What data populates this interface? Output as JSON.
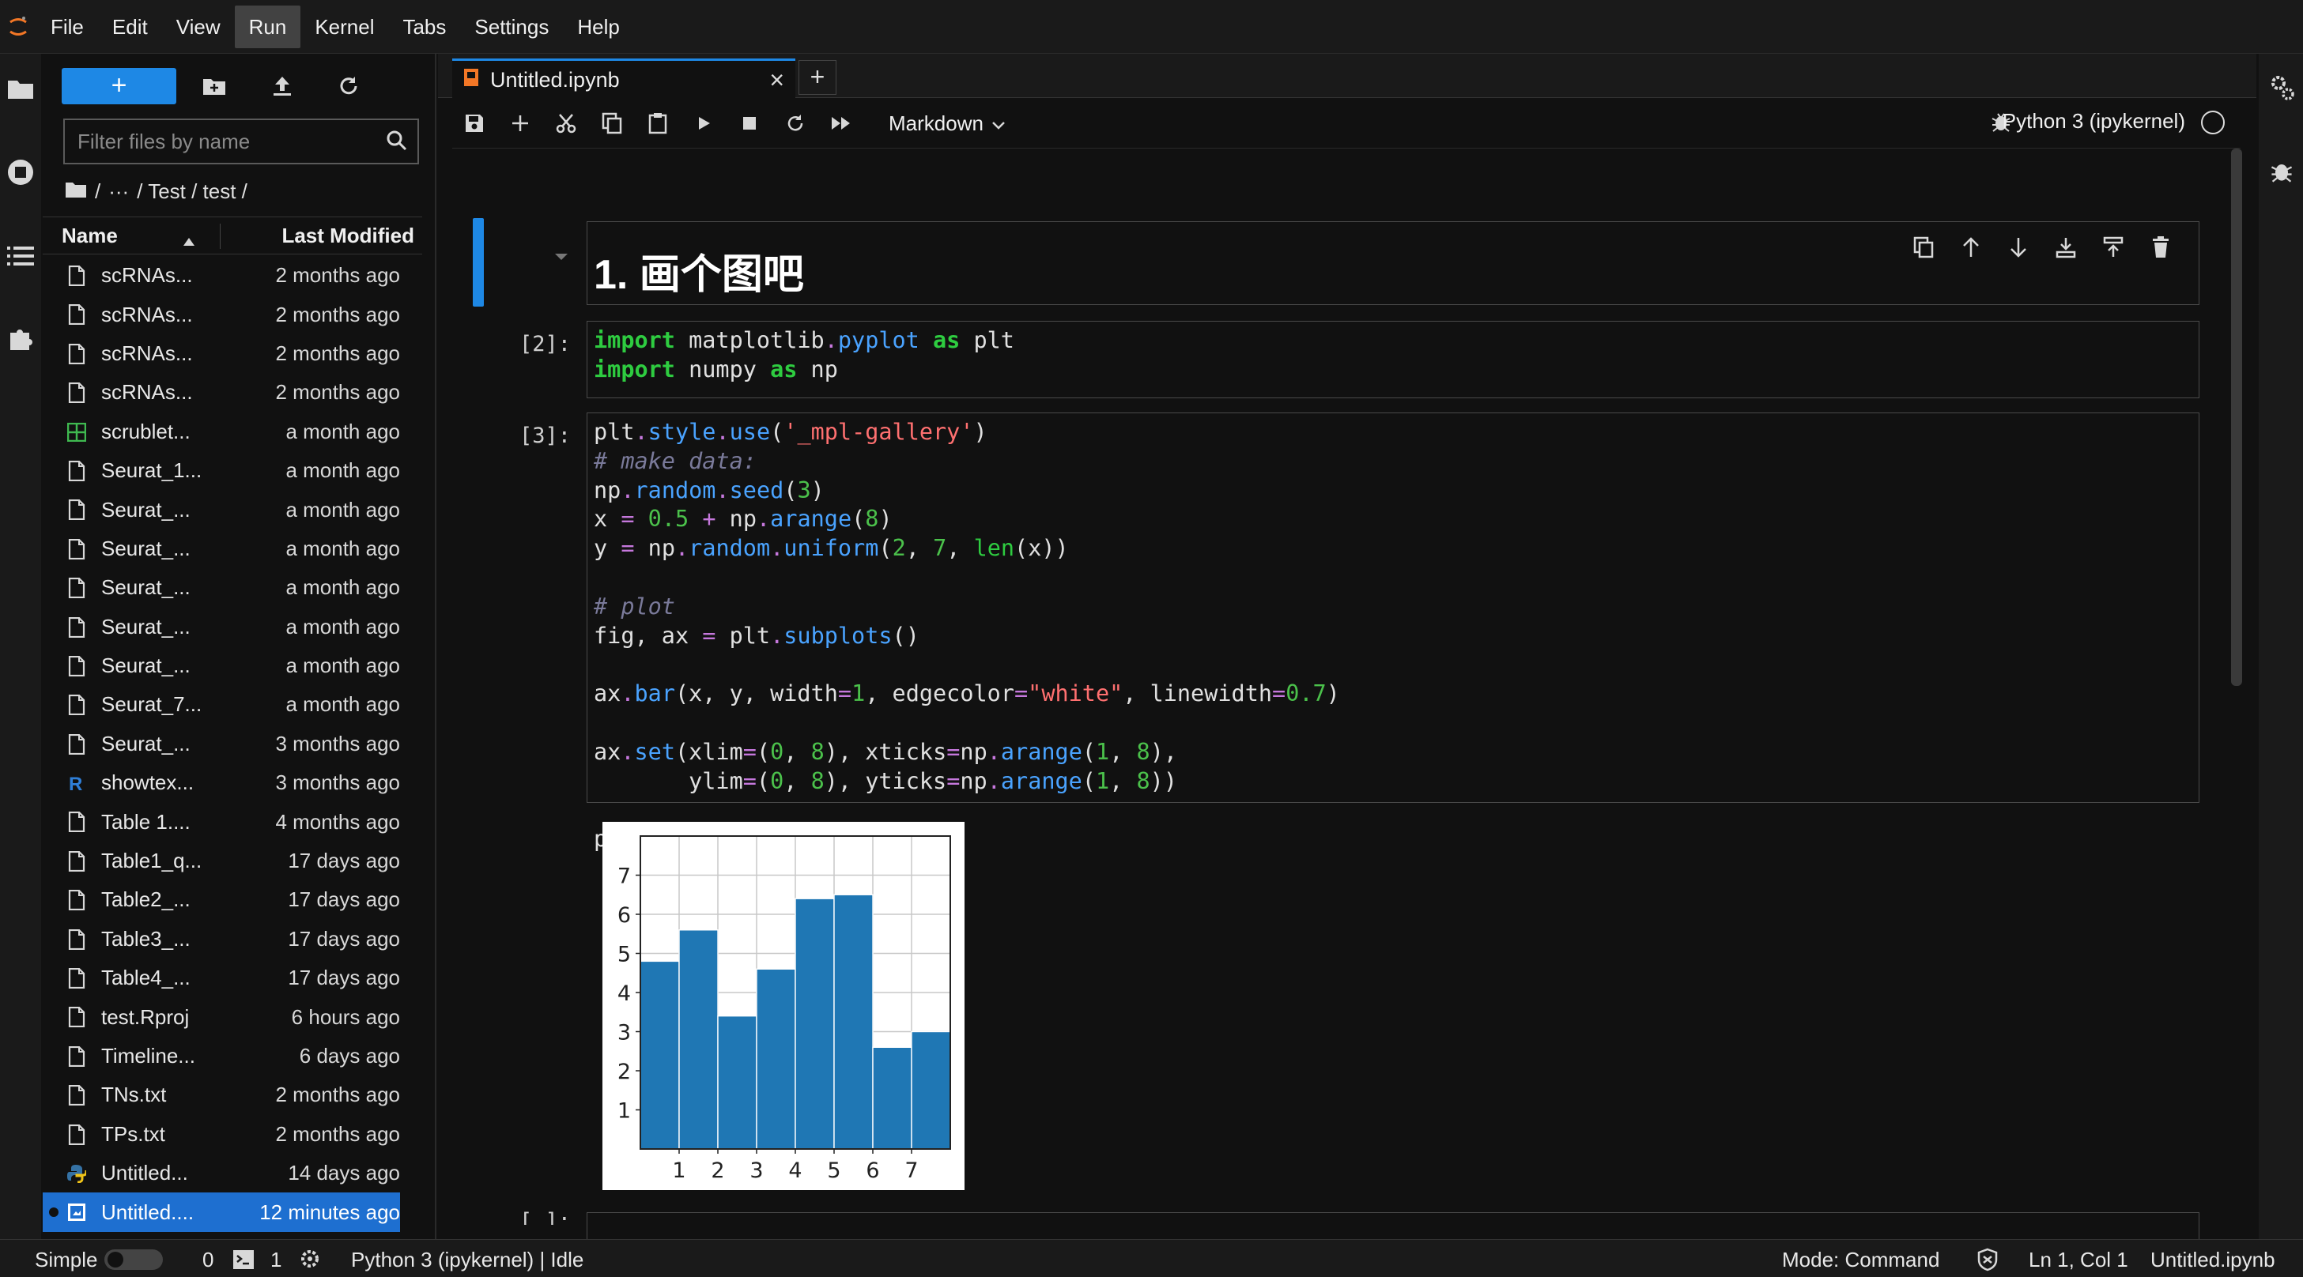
{
  "menubar": {
    "items": [
      "File",
      "Edit",
      "View",
      "Run",
      "Kernel",
      "Tabs",
      "Settings",
      "Help"
    ],
    "active": "Run"
  },
  "filebrowser": {
    "filter_placeholder": "Filter files by name",
    "breadcrumb": [
      "/",
      "···",
      "/ Test / test /"
    ],
    "header": {
      "name": "Name",
      "modified": "Last Modified"
    },
    "files": [
      {
        "name": "scRNAs...",
        "modified": "2 months ago",
        "icon": "file-icon"
      },
      {
        "name": "scRNAs...",
        "modified": "2 months ago",
        "icon": "file-icon"
      },
      {
        "name": "scRNAs...",
        "modified": "2 months ago",
        "icon": "file-icon"
      },
      {
        "name": "scRNAs...",
        "modified": "2 months ago",
        "icon": "file-icon"
      },
      {
        "name": "scrublet...",
        "modified": "a month ago",
        "icon": "spreadsheet-icon"
      },
      {
        "name": "Seurat_1...",
        "modified": "a month ago",
        "icon": "file-icon"
      },
      {
        "name": "Seurat_...",
        "modified": "a month ago",
        "icon": "file-icon"
      },
      {
        "name": "Seurat_...",
        "modified": "a month ago",
        "icon": "file-icon"
      },
      {
        "name": "Seurat_...",
        "modified": "a month ago",
        "icon": "file-icon"
      },
      {
        "name": "Seurat_...",
        "modified": "a month ago",
        "icon": "file-icon"
      },
      {
        "name": "Seurat_...",
        "modified": "a month ago",
        "icon": "file-icon"
      },
      {
        "name": "Seurat_7...",
        "modified": "a month ago",
        "icon": "file-icon"
      },
      {
        "name": "Seurat_...",
        "modified": "3 months ago",
        "icon": "file-icon"
      },
      {
        "name": "showtex...",
        "modified": "3 months ago",
        "icon": "r-icon"
      },
      {
        "name": "Table 1....",
        "modified": "4 months ago",
        "icon": "file-icon"
      },
      {
        "name": "Table1_q...",
        "modified": "17 days ago",
        "icon": "file-icon"
      },
      {
        "name": "Table2_...",
        "modified": "17 days ago",
        "icon": "file-icon"
      },
      {
        "name": "Table3_...",
        "modified": "17 days ago",
        "icon": "file-icon"
      },
      {
        "name": "Table4_...",
        "modified": "17 days ago",
        "icon": "file-icon"
      },
      {
        "name": "test.Rproj",
        "modified": "6 hours ago",
        "icon": "file-icon"
      },
      {
        "name": "Timeline...",
        "modified": "6 days ago",
        "icon": "file-icon"
      },
      {
        "name": "TNs.txt",
        "modified": "2 months ago",
        "icon": "file-icon"
      },
      {
        "name": "TPs.txt",
        "modified": "2 months ago",
        "icon": "file-icon"
      },
      {
        "name": "Untitled...",
        "modified": "14 days ago",
        "icon": "python-icon"
      },
      {
        "name": "Untitled....",
        "modified": "12 minutes ago",
        "icon": "notebook-icon"
      }
    ]
  },
  "tab": {
    "title": "Untitled.ipynb",
    "close": "×",
    "add": "+"
  },
  "toolbar": {
    "cell_type": "Markdown",
    "kernel": "Python 3 (ipykernel)"
  },
  "cells": {
    "markdown_heading": "1. 画个图吧",
    "cell2_prompt": "[2]:",
    "cell3_prompt": "[3]:",
    "cell4_prompt": "[ ]:"
  },
  "chart_data": {
    "type": "bar",
    "x": [
      0.5,
      1.5,
      2.5,
      3.5,
      4.5,
      5.5,
      6.5,
      7.5
    ],
    "values": [
      4.8,
      5.6,
      3.4,
      4.6,
      6.4,
      6.5,
      2.6,
      3.0
    ],
    "xlim": [
      0,
      8
    ],
    "ylim": [
      0,
      8
    ],
    "xticks": [
      "1",
      "2",
      "3",
      "4",
      "5",
      "6",
      "7"
    ],
    "yticks": [
      "1",
      "2",
      "3",
      "4",
      "5",
      "6",
      "7"
    ],
    "bar_color": "#1f77b4",
    "edge_color": "#ffffff",
    "grid": true
  },
  "statusbar": {
    "mode_label": "Simple",
    "terminals": "0",
    "kernels": "1",
    "kernel_status": "Python 3 (ipykernel) | Idle",
    "mode": "Mode: Command",
    "cursor": "Ln 1, Col 1",
    "file": "Untitled.ipynb"
  },
  "colors": {
    "accent": "#1e88e5",
    "background": "#111111"
  }
}
